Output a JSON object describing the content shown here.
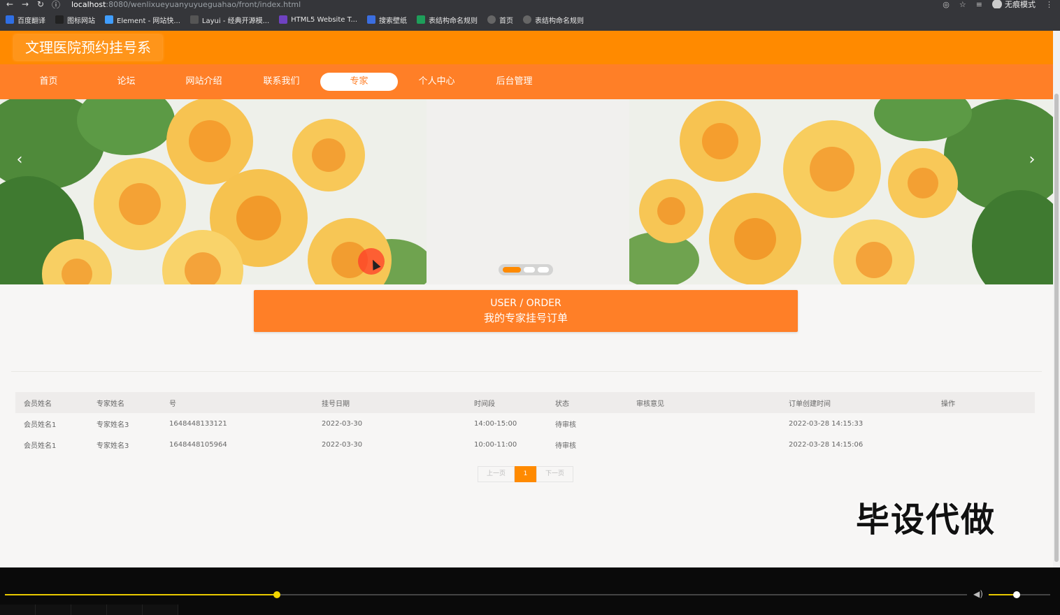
{
  "browser": {
    "url_host": "localhost",
    "url_rest": ":8080/wenlixueyuanyuyueguahao/front/index.html",
    "profile_label": "无痕模式"
  },
  "bookmarks": [
    {
      "label": "百度翻译",
      "color": "#2f6fe4"
    },
    {
      "label": "图标网站",
      "color": "#222222"
    },
    {
      "label": "Element - 网站快...",
      "color": "#409eff"
    },
    {
      "label": "Layui - 经典开源模...",
      "color": "#555555"
    },
    {
      "label": "HTML5 Website T...",
      "color": "#6f42c1"
    },
    {
      "label": "搜索壁纸",
      "color": "#3b6ee0"
    },
    {
      "label": "表结构命名规则",
      "color": "#1e9e5a"
    },
    {
      "label": "首页",
      "color": "#666666"
    },
    {
      "label": "表结构命名规则",
      "color": "#666666"
    }
  ],
  "site": {
    "title": "文理医院预约挂号系"
  },
  "nav": [
    {
      "label": "首页",
      "active": false
    },
    {
      "label": "论坛",
      "active": false
    },
    {
      "label": "网站介绍",
      "active": false
    },
    {
      "label": "联系我们",
      "active": false
    },
    {
      "label": "专家",
      "active": true
    },
    {
      "label": "个人中心",
      "active": false
    },
    {
      "label": "后台管理",
      "active": false
    }
  ],
  "banner": {
    "prev": "‹",
    "next": "›"
  },
  "section": {
    "en": "USER / ORDER",
    "cn": "我的专家挂号订单"
  },
  "table": {
    "headers": [
      "会员姓名",
      "专家姓名",
      "号",
      "挂号日期",
      "时间段",
      "状态",
      "审核意见",
      "订单创建时间",
      "操作"
    ],
    "rows": [
      [
        "会员姓名1",
        "专家姓名3",
        "1648448133121",
        "2022-03-30",
        "14:00-15:00",
        "待审核",
        "",
        "2022-03-28 14:15:33",
        ""
      ],
      [
        "会员姓名1",
        "专家姓名3",
        "1648448105964",
        "2022-03-30",
        "10:00-11:00",
        "待审核",
        "",
        "2022-03-28 14:15:06",
        ""
      ]
    ]
  },
  "pager": {
    "prev": "上一页",
    "current": "1",
    "next": "下一页"
  },
  "watermark": "毕设代做",
  "player": {
    "progress": 0.283,
    "volume": 0.45,
    "accent": "#e8c800"
  },
  "colors": {
    "topbar": "#ff8a00",
    "navbar": "#ff7f27",
    "section_head": "#ff7f27"
  }
}
